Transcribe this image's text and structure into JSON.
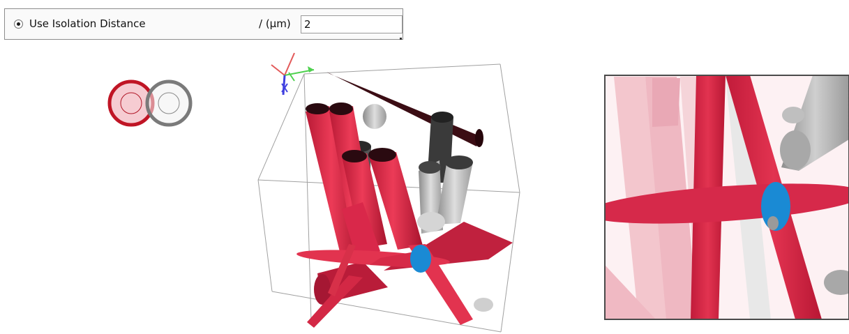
{
  "panel": {
    "option_label": "Use Isolation Distance",
    "option_selected": true,
    "unit_label": "/ (μm)",
    "distance_value": "2"
  },
  "colors": {
    "fiber_red": "#e0304c",
    "fiber_gray": "#bdbdbd",
    "contact_blue": "#1a8ad4",
    "overlap_ring_red": "#c01525",
    "overlap_ring_gray": "#7a7a7a",
    "bounding_box": "#9a9a9a"
  },
  "icons": {
    "axes": "axes-orientation-icon",
    "overlap": "overlapping-circles-icon"
  },
  "views": {
    "main": "3d-fiber-view",
    "inset": "zoomed-detail-view"
  }
}
